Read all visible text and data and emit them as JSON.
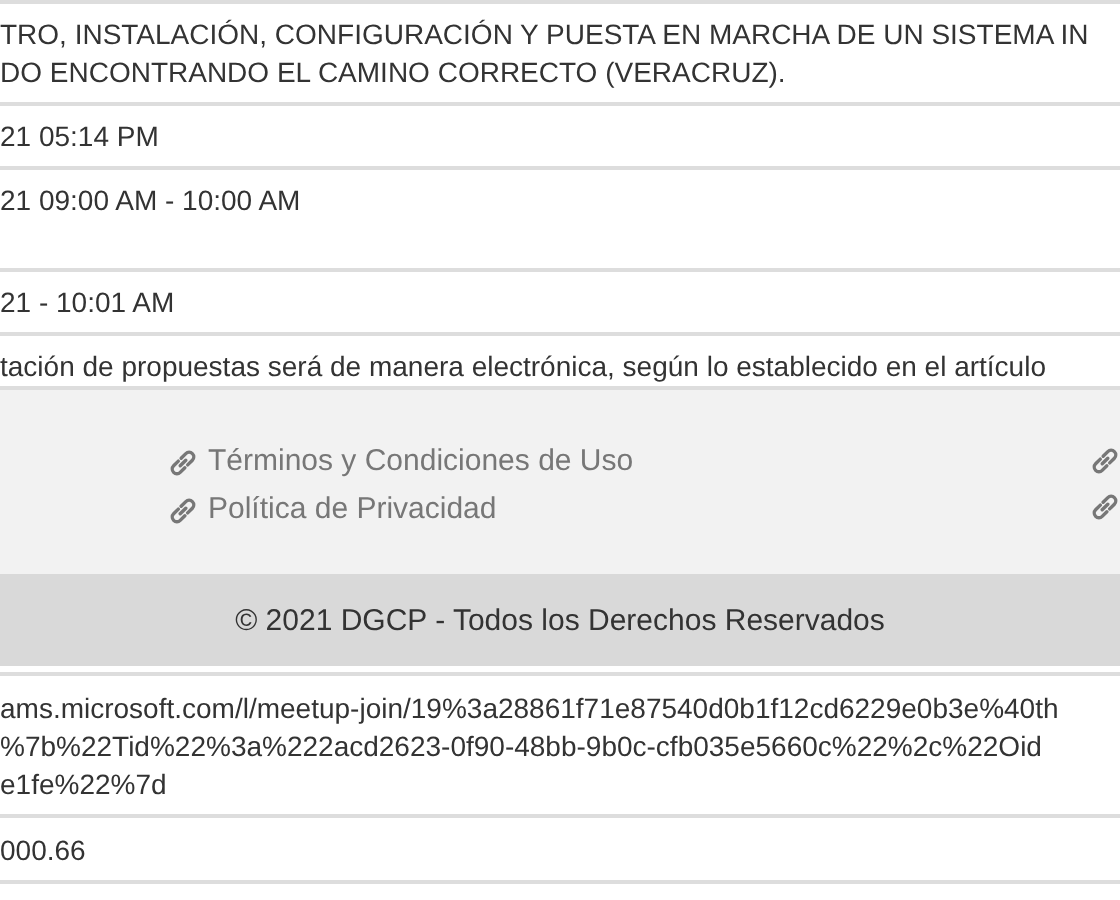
{
  "details": [
    {
      "lines": [
        "TRO, INSTALACIÓN, CONFIGURACIÓN Y PUESTA EN MARCHA DE UN SISTEMA IN",
        "DO ENCONTRANDO EL CAMINO CORRECTO (VERACRUZ)."
      ]
    },
    {
      "lines": [
        "21 05:14 PM"
      ]
    },
    {
      "lines": [
        "21 09:00 AM - 10:00 AM"
      ]
    },
    {
      "lines": [
        "21 - 10:01 AM"
      ]
    },
    {
      "lines": [
        "tación de propuestas será de manera electrónica, según lo establecido en el artículo"
      ]
    }
  ],
  "footer": {
    "links": [
      "Términos y Condiciones de Uso",
      "Política de Privacidad"
    ],
    "right_column": [
      {
        "kind": "link_icon"
      },
      {
        "kind": "link_icon"
      }
    ],
    "copyright": "© 2021 DGCP - Todos los Derechos Reservados"
  },
  "more_details": [
    {
      "lines": [
        "ams.microsoft.com/l/meetup-join/19%3a28861f71e87540d0b1f12cd6229e0b3e%40th",
        "%7b%22Tid%22%3a%222acd2623-0f90-48bb-9b0c-cfb035e5660c%22%2c%22Oid",
        "e1fe%22%7d"
      ]
    },
    {
      "lines": [
        "000.66"
      ]
    }
  ]
}
